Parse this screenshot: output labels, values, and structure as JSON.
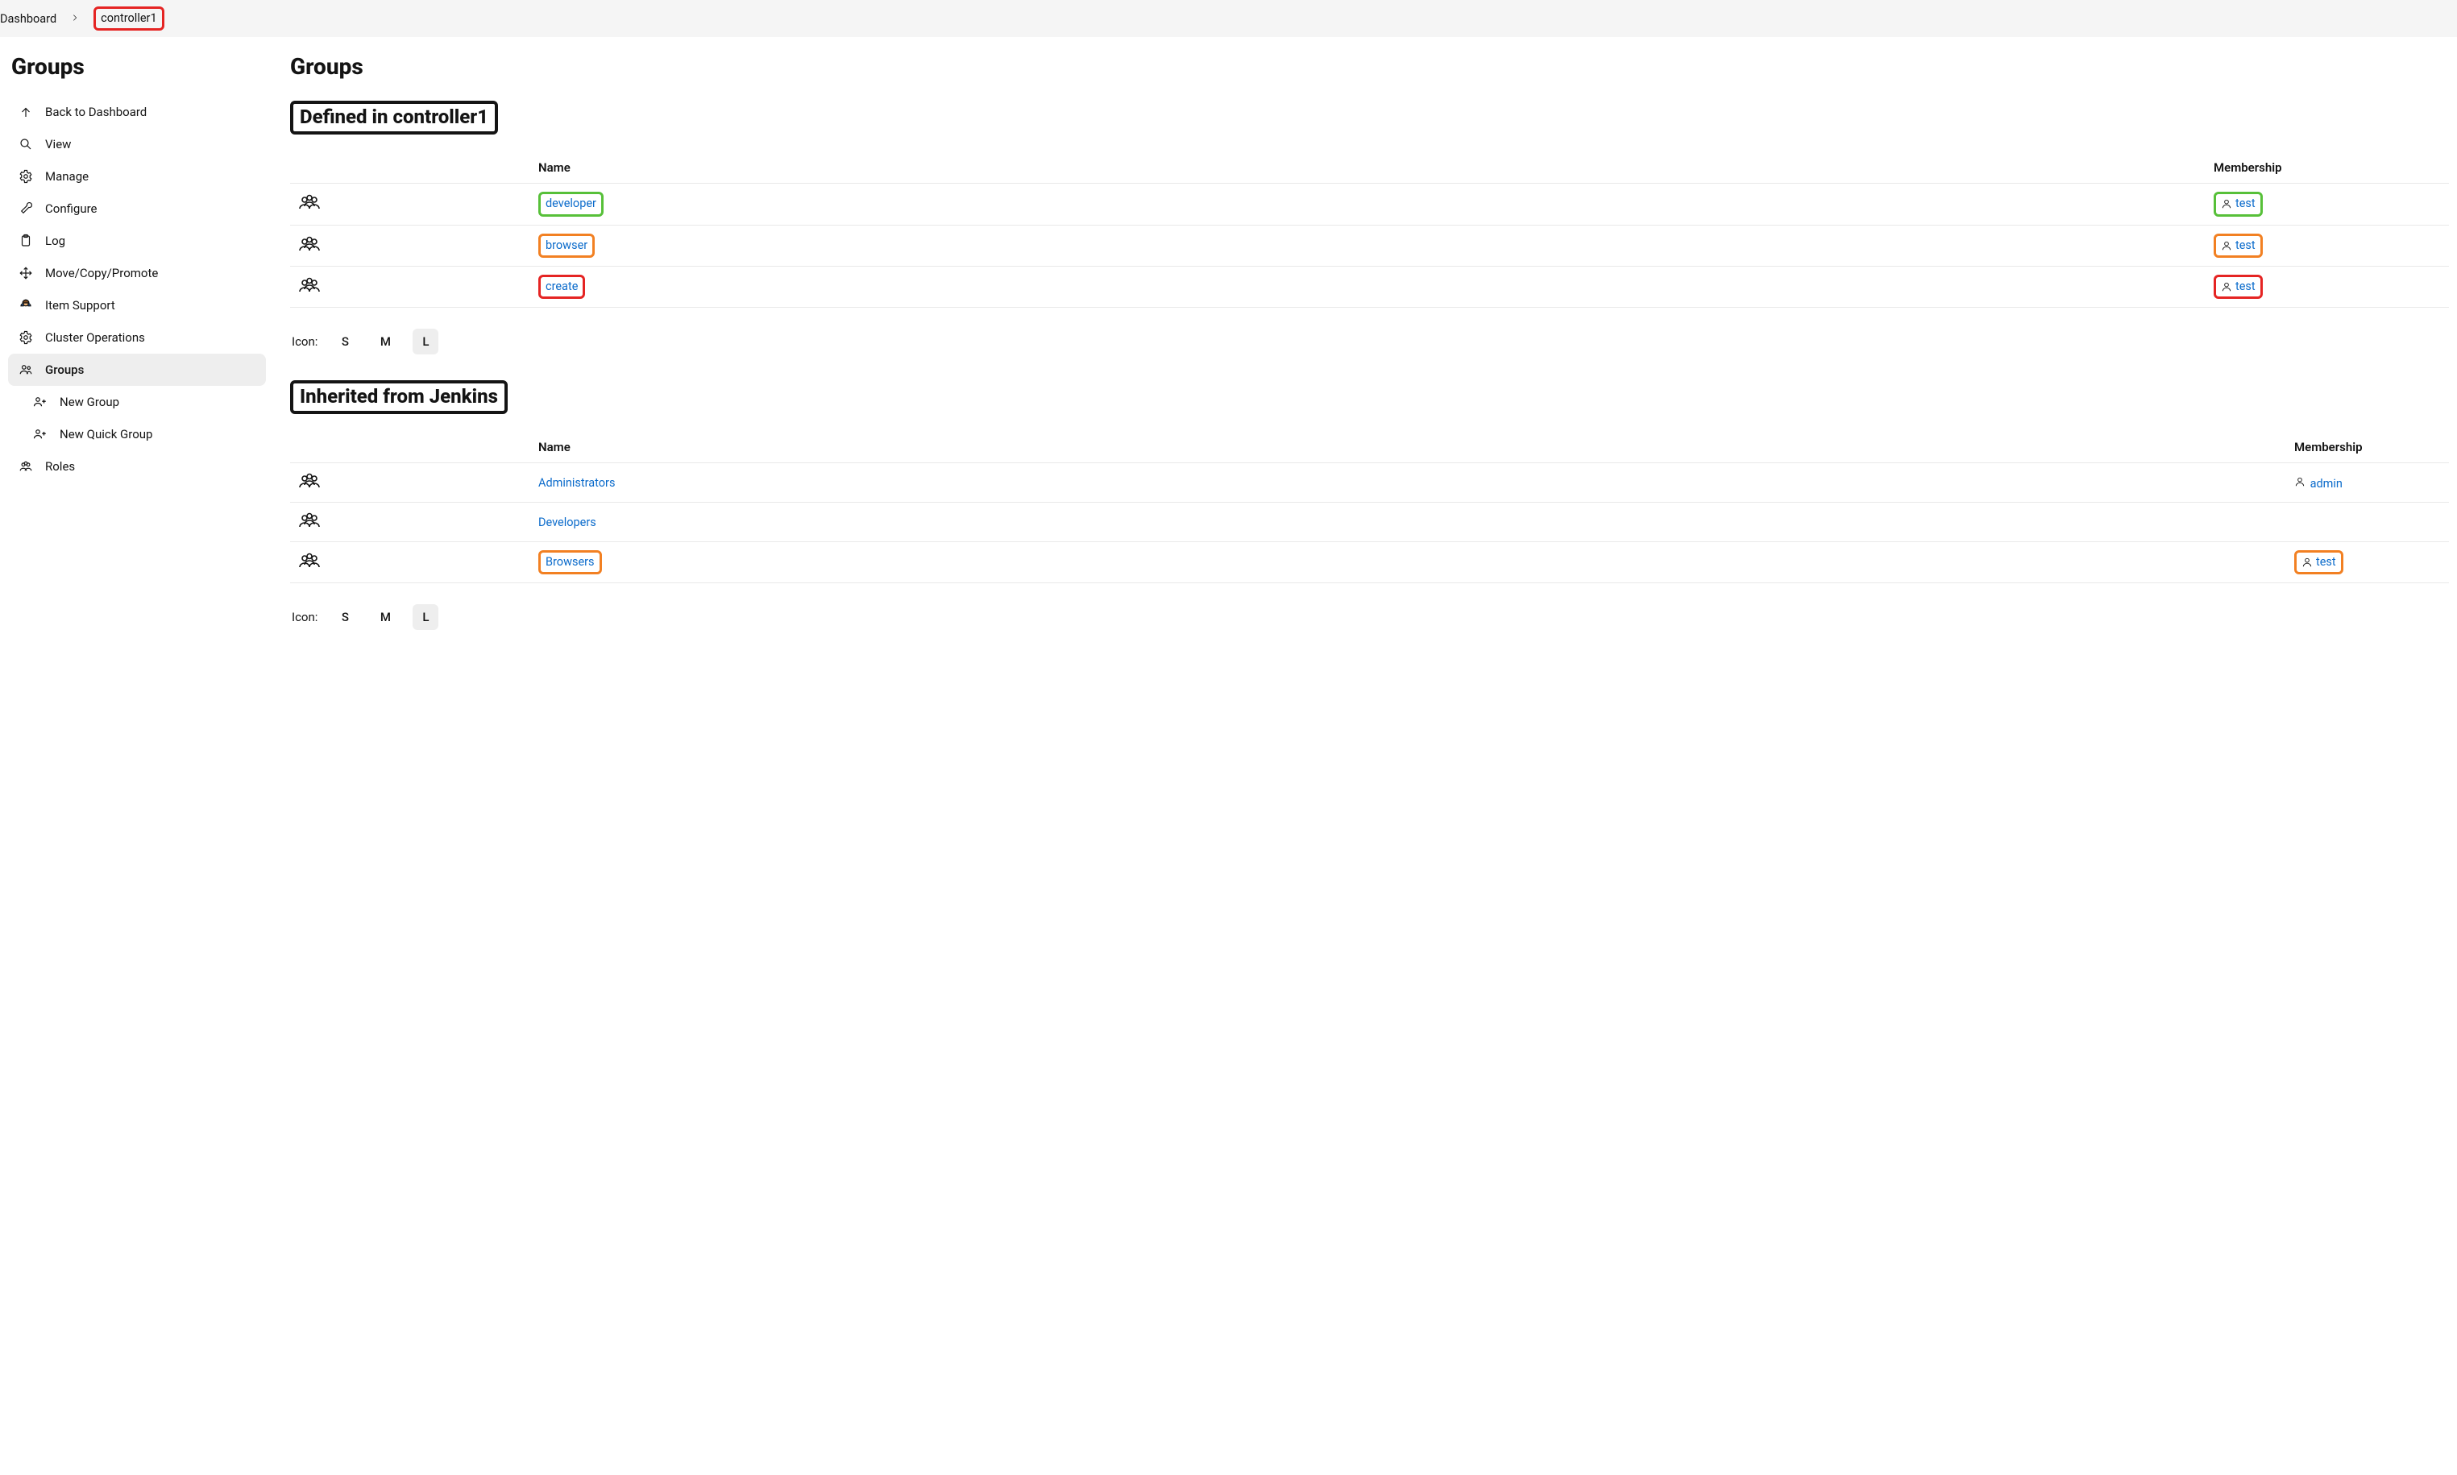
{
  "breadcrumb": {
    "dashboard": "Dashboard",
    "current": "controller1"
  },
  "sidebar": {
    "title": "Groups",
    "items": {
      "back": "Back to Dashboard",
      "view": "View",
      "manage": "Manage",
      "configure": "Configure",
      "log": "Log",
      "move": "Move/Copy/Promote",
      "support": "Item Support",
      "cluster": "Cluster Operations",
      "groups": "Groups",
      "new_group": "New Group",
      "new_quick_group": "New Quick Group",
      "roles": "Roles"
    }
  },
  "content": {
    "page_title": "Groups",
    "icon_label": "Icon:",
    "sizes": {
      "s": "S",
      "m": "M",
      "l": "L"
    },
    "section_defined": {
      "heading": "Defined in controller1",
      "highlight": "red",
      "name_header": "Name",
      "membership_header": "Membership",
      "rows": [
        {
          "name": "developer",
          "member": "test",
          "highlight": "green"
        },
        {
          "name": "browser",
          "member": "test",
          "highlight": "orange"
        },
        {
          "name": "create",
          "member": "test",
          "highlight": "red"
        }
      ]
    },
    "section_inherited": {
      "heading": "Inherited from Jenkins",
      "highlight": "orange",
      "name_header": "Name",
      "membership_header": "Membership",
      "rows": [
        {
          "name": "Administrators",
          "member": "admin",
          "highlight": ""
        },
        {
          "name": "Developers",
          "member": "",
          "highlight": ""
        },
        {
          "name": "Browsers",
          "member": "test",
          "highlight": "orange"
        }
      ]
    }
  },
  "colors": {
    "red": "#e52423",
    "orange": "#f28022",
    "green": "#57c039",
    "link": "#0b6bcb"
  }
}
